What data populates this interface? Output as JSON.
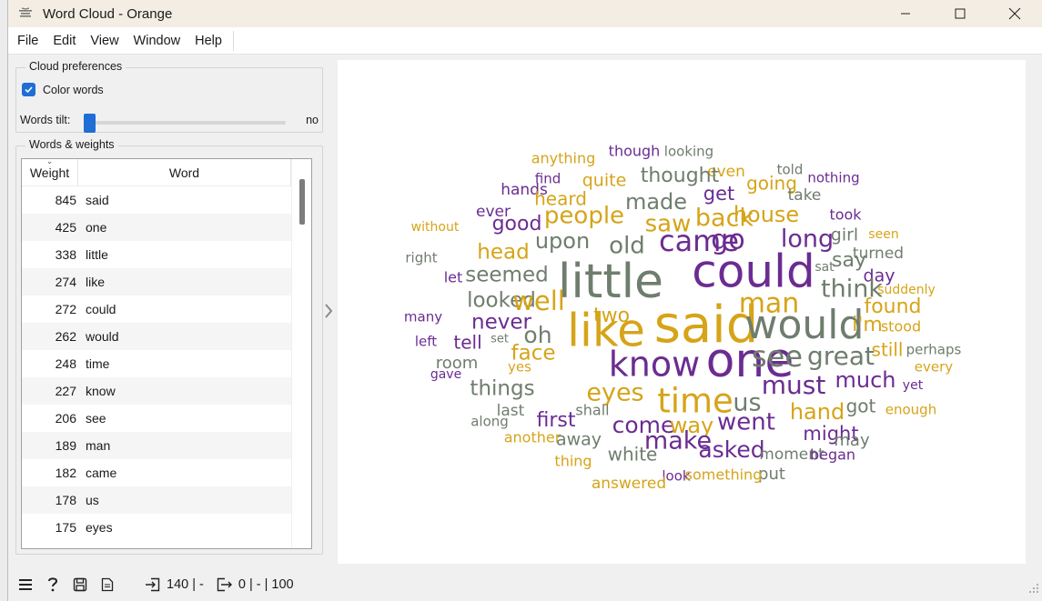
{
  "window": {
    "title": "Word Cloud - Orange"
  },
  "menu": [
    "File",
    "Edit",
    "View",
    "Window",
    "Help"
  ],
  "preferences": {
    "title": "Cloud preferences",
    "color_words_label": "Color words",
    "color_words_checked": true,
    "tilt_label": "Words tilt:",
    "tilt_value": "no"
  },
  "words_weights": {
    "title": "Words & weights",
    "headers": {
      "weight": "Weight",
      "word": "Word"
    },
    "rows": [
      {
        "weight": "845",
        "word": "said"
      },
      {
        "weight": "425",
        "word": "one"
      },
      {
        "weight": "338",
        "word": "little"
      },
      {
        "weight": "274",
        "word": "like"
      },
      {
        "weight": "272",
        "word": "could"
      },
      {
        "weight": "262",
        "word": "would"
      },
      {
        "weight": "248",
        "word": "time"
      },
      {
        "weight": "227",
        "word": "know"
      },
      {
        "weight": "206",
        "word": "see"
      },
      {
        "weight": "189",
        "word": "man"
      },
      {
        "weight": "182",
        "word": "came"
      },
      {
        "weight": "178",
        "word": "us"
      },
      {
        "weight": "175",
        "word": "eyes"
      }
    ]
  },
  "status": {
    "input_count": "140 | -",
    "output_count": "0 | - | 100"
  },
  "colors": {
    "gold": "#d6a419",
    "purple": "#6b2c91",
    "gray": "#6f7d6e",
    "accent": "#1e6ed6"
  },
  "cloud_words": [
    {
      "t": "anything",
      "c": "gold"
    },
    {
      "t": "though",
      "c": "purple"
    },
    {
      "t": "looking",
      "c": "gray"
    },
    {
      "t": "even",
      "c": "gold"
    },
    {
      "t": "told",
      "c": "gray"
    },
    {
      "t": "nothing",
      "c": "purple"
    },
    {
      "t": "find",
      "c": "purple"
    },
    {
      "t": "quite",
      "c": "gold"
    },
    {
      "t": "thought",
      "c": "gray"
    },
    {
      "t": "going",
      "c": "gold"
    },
    {
      "t": "hands",
      "c": "purple"
    },
    {
      "t": "get",
      "c": "purple"
    },
    {
      "t": "take",
      "c": "gray"
    },
    {
      "t": "heard",
      "c": "gold"
    },
    {
      "t": "made",
      "c": "gray"
    },
    {
      "t": "ever",
      "c": "purple"
    },
    {
      "t": "people",
      "c": "gold"
    },
    {
      "t": "house",
      "c": "gold"
    },
    {
      "t": "took",
      "c": "purple"
    },
    {
      "t": "without",
      "c": "gold"
    },
    {
      "t": "good",
      "c": "purple"
    },
    {
      "t": "saw",
      "c": "gold"
    },
    {
      "t": "back",
      "c": "gold"
    },
    {
      "t": "girl",
      "c": "gray"
    },
    {
      "t": "seen",
      "c": "gold"
    },
    {
      "t": "upon",
      "c": "gray"
    },
    {
      "t": "came",
      "c": "purple"
    },
    {
      "t": "go",
      "c": "purple"
    },
    {
      "t": "long",
      "c": "purple"
    },
    {
      "t": "old",
      "c": "gray"
    },
    {
      "t": "head",
      "c": "gold"
    },
    {
      "t": "turned",
      "c": "gray"
    },
    {
      "t": "right",
      "c": "gray"
    },
    {
      "t": "say",
      "c": "gray"
    },
    {
      "t": "sat",
      "c": "gray"
    },
    {
      "t": "day",
      "c": "purple"
    },
    {
      "t": "let",
      "c": "purple"
    },
    {
      "t": "seemed",
      "c": "gray"
    },
    {
      "t": "could",
      "c": "purple"
    },
    {
      "t": "little",
      "c": "gray"
    },
    {
      "t": "think",
      "c": "gray"
    },
    {
      "t": "suddenly",
      "c": "gold"
    },
    {
      "t": "looked",
      "c": "gray"
    },
    {
      "t": "well",
      "c": "gold"
    },
    {
      "t": "man",
      "c": "gold"
    },
    {
      "t": "found",
      "c": "gold"
    },
    {
      "t": "two",
      "c": "gold"
    },
    {
      "t": "many",
      "c": "purple"
    },
    {
      "t": "never",
      "c": "purple"
    },
    {
      "t": "said",
      "c": "gold"
    },
    {
      "t": "would",
      "c": "gray"
    },
    {
      "t": "i'm",
      "c": "gold"
    },
    {
      "t": "stood",
      "c": "gold"
    },
    {
      "t": "oh",
      "c": "gray"
    },
    {
      "t": "like",
      "c": "gold"
    },
    {
      "t": "left",
      "c": "purple"
    },
    {
      "t": "set",
      "c": "gray"
    },
    {
      "t": "tell",
      "c": "purple"
    },
    {
      "t": "face",
      "c": "gold"
    },
    {
      "t": "still",
      "c": "gold"
    },
    {
      "t": "perhaps",
      "c": "gray"
    },
    {
      "t": "room",
      "c": "gray"
    },
    {
      "t": "know",
      "c": "purple"
    },
    {
      "t": "one",
      "c": "purple"
    },
    {
      "t": "see",
      "c": "gray"
    },
    {
      "t": "great",
      "c": "gray"
    },
    {
      "t": "yes",
      "c": "gold"
    },
    {
      "t": "every",
      "c": "gold"
    },
    {
      "t": "gave",
      "c": "purple"
    },
    {
      "t": "much",
      "c": "purple"
    },
    {
      "t": "must",
      "c": "purple"
    },
    {
      "t": "yet",
      "c": "purple"
    },
    {
      "t": "things",
      "c": "gray"
    },
    {
      "t": "eyes",
      "c": "gold"
    },
    {
      "t": "time",
      "c": "gold"
    },
    {
      "t": "us",
      "c": "gray"
    },
    {
      "t": "hand",
      "c": "gold"
    },
    {
      "t": "got",
      "c": "gray"
    },
    {
      "t": "last",
      "c": "gray"
    },
    {
      "t": "shall",
      "c": "gray"
    },
    {
      "t": "enough",
      "c": "gold"
    },
    {
      "t": "first",
      "c": "purple"
    },
    {
      "t": "along",
      "c": "gray"
    },
    {
      "t": "come",
      "c": "purple"
    },
    {
      "t": "way",
      "c": "gold"
    },
    {
      "t": "went",
      "c": "purple"
    },
    {
      "t": "might",
      "c": "purple"
    },
    {
      "t": "another",
      "c": "gold"
    },
    {
      "t": "away",
      "c": "gray"
    },
    {
      "t": "make",
      "c": "purple"
    },
    {
      "t": "may",
      "c": "gray"
    },
    {
      "t": "asked",
      "c": "purple"
    },
    {
      "t": "moment",
      "c": "gray"
    },
    {
      "t": "began",
      "c": "purple"
    },
    {
      "t": "white",
      "c": "gray"
    },
    {
      "t": "thing",
      "c": "gold"
    },
    {
      "t": "put",
      "c": "gray"
    },
    {
      "t": "look",
      "c": "purple"
    },
    {
      "t": "something",
      "c": "gold"
    },
    {
      "t": "answered",
      "c": "gold"
    }
  ]
}
